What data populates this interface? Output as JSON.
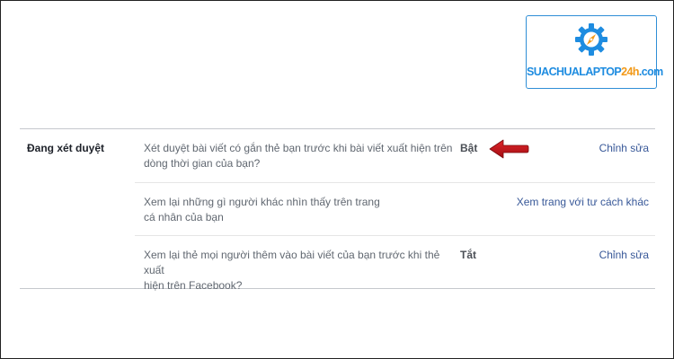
{
  "logo": {
    "text_blue": "SUACHUALAPTOP",
    "text_orange": "24h",
    "text_suffix": ".com",
    "blue_color": "#1e8ce0",
    "orange_color": "#f29a1a"
  },
  "section": {
    "label": "Đang xét duyệt",
    "rows": [
      {
        "description_line1": "Xét duyệt bài viết có gắn thẻ bạn trước khi bài viết xuất hiện trên",
        "description_line2": "dòng thời gian của bạn?",
        "status": "Bật",
        "action": "Chỉnh sửa"
      },
      {
        "description_line1": "Xem lại những gì người khác nhìn thấy trên trang",
        "description_line2": "cá nhân của bạn",
        "status": "",
        "action": "Xem trang với tư cách khác"
      },
      {
        "description_line1": "Xem lại thẻ mọi người thêm vào bài viết của bạn trước khi thẻ xuất",
        "description_line2": "hiện trên Facebook?",
        "status": "Tắt",
        "action": "Chỉnh sửa"
      }
    ]
  },
  "annotation": {
    "arrow_color": "#c0141a",
    "arrow_icon": "red-arrow-left-icon"
  }
}
